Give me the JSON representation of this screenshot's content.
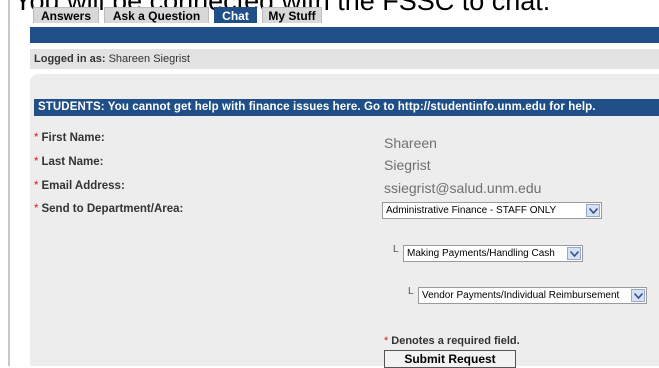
{
  "banner": {
    "text": "You will be connected with the FSSC to chat."
  },
  "tabs": [
    {
      "label": "Answers",
      "active": false
    },
    {
      "label": "Ask a Question",
      "active": false
    },
    {
      "label": "Chat",
      "active": true
    },
    {
      "label": "My Stuff",
      "active": false
    }
  ],
  "session": {
    "prefix": "Logged in as:",
    "user": "Shareen Siegrist"
  },
  "notice": {
    "text": "STUDENTS: You cannot get help with finance issues here. Go to http://studentinfo.unm.edu for help."
  },
  "form": {
    "required_mark": "*",
    "first_name_label": "First Name:",
    "first_name_value": "Shareen",
    "last_name_label": "Last Name:",
    "last_name_value": "Siegrist",
    "email_label": "Email Address:",
    "email_value": "ssiegrist@salud.unm.edu",
    "department_label": "Send to Department/Area:",
    "department_select": "Administrative Finance - STAFF ONLY",
    "sub_select_1": "Making Payments/Handling Cash",
    "sub_select_2": "Vendor Payments/Individual Reimbursement",
    "elbow_glyph": "L",
    "required_note": "Denotes a required field.",
    "submit_label": "Submit Request"
  },
  "colors": {
    "brand_blue": "#1f4f86",
    "required_red": "#e02020",
    "panel_gray": "#ededed"
  }
}
